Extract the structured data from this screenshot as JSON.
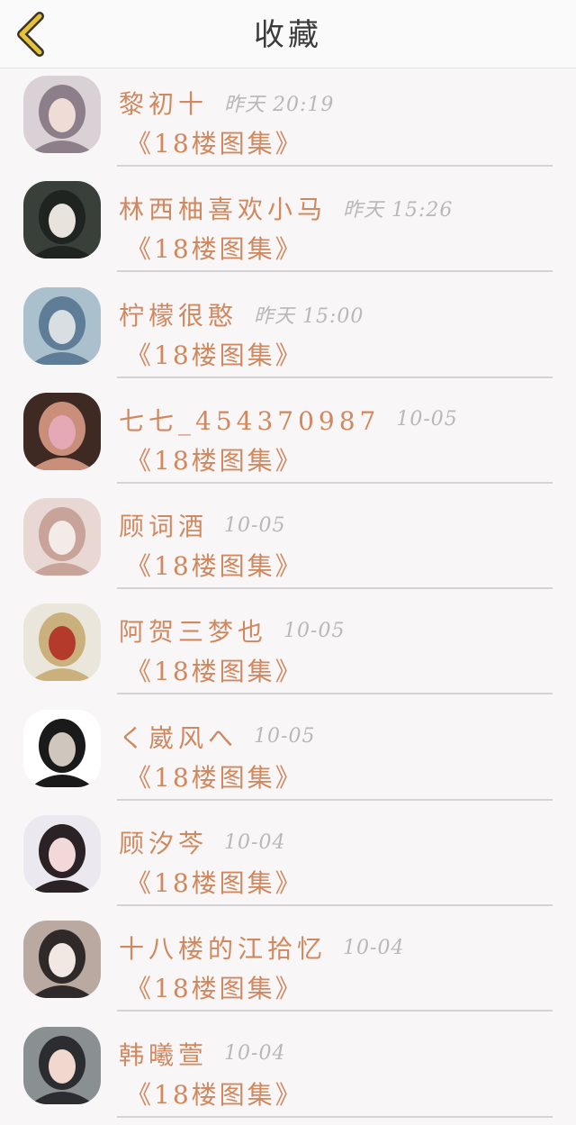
{
  "header": {
    "title": "收藏",
    "back_icon": "chevron-left-icon",
    "accent_color": "#e6c23a"
  },
  "favorites": [
    {
      "name": "黎初十",
      "time": "昨天 20:19",
      "group": "《18楼图集》",
      "avatar_colors": [
        "#d9d1d6",
        "#8d7f89",
        "#f0dcd6"
      ]
    },
    {
      "name": "林西柚喜欢小马",
      "time": "昨天 15:26",
      "group": "《18楼图集》",
      "avatar_colors": [
        "#39403a",
        "#1f2420",
        "#e8e3dc"
      ]
    },
    {
      "name": "柠檬很憨",
      "time": "昨天 15:00",
      "group": "《18楼图集》",
      "avatar_colors": [
        "#aac0cc",
        "#5f7d96",
        "#d8dfe3"
      ]
    },
    {
      "name": "七七_454370987",
      "time": "10-05",
      "group": "《18楼图集》",
      "avatar_colors": [
        "#3e2a22",
        "#c98f7a",
        "#e4a9b5"
      ]
    },
    {
      "name": "顾词酒",
      "time": "10-05",
      "group": "《18楼图集》",
      "avatar_colors": [
        "#e8d7d3",
        "#c7a39a",
        "#f3ebe7"
      ]
    },
    {
      "name": "阿贺三梦也",
      "time": "10-05",
      "group": "《18楼图集》",
      "avatar_colors": [
        "#eae6dc",
        "#c9b07c",
        "#b43a2c"
      ]
    },
    {
      "name": "く崴风へ",
      "time": "10-05",
      "group": "《18楼图集》",
      "avatar_colors": [
        "#ffffff",
        "#1a1a1a",
        "#cfc7bd"
      ]
    },
    {
      "name": "顾汐芩",
      "time": "10-04",
      "group": "《18楼图集》",
      "avatar_colors": [
        "#ece8f0",
        "#2b2225",
        "#f2d8d8"
      ]
    },
    {
      "name": "十八楼的江拾忆",
      "time": "10-04",
      "group": "《18楼图集》",
      "avatar_colors": [
        "#b9a9a1",
        "#2f2a29",
        "#f1e7e3"
      ]
    },
    {
      "name": "韩曦萱",
      "time": "10-04",
      "group": "《18楼图集》",
      "avatar_colors": [
        "#8a8f92",
        "#2b2d30",
        "#f0d8cf"
      ]
    }
  ]
}
